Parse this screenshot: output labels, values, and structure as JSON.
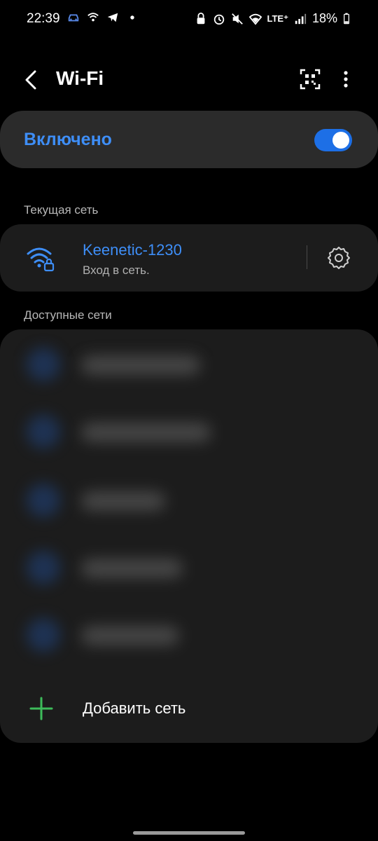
{
  "status_bar": {
    "time": "22:39",
    "network": "LTE⁺",
    "battery": "18%",
    "icons": [
      "car-icon",
      "wifi-calling-icon",
      "telegram-icon",
      "dot-icon",
      "lock-icon",
      "alarm-icon",
      "mute-icon",
      "wifi-icon",
      "lte-icon",
      "signal-icon",
      "battery-icon"
    ]
  },
  "header": {
    "title": "Wi-Fi",
    "icons": [
      "back-icon",
      "qr-code-icon",
      "more-icon"
    ]
  },
  "toggle": {
    "label": "Включено",
    "state": "on",
    "accent": "#3e8ef7"
  },
  "current_section": {
    "title": "Текущая сеть",
    "network_name": "Keenetic-1230",
    "status": "Вход в сеть."
  },
  "available_section": {
    "title": "Доступные сети",
    "add_label": "Добавить сеть"
  },
  "colors": {
    "background": "#000000",
    "card": "#1c1c1c",
    "toggle_card": "#2b2b2b",
    "accent": "#3e8ef7",
    "add_icon": "#3dbb5a"
  }
}
